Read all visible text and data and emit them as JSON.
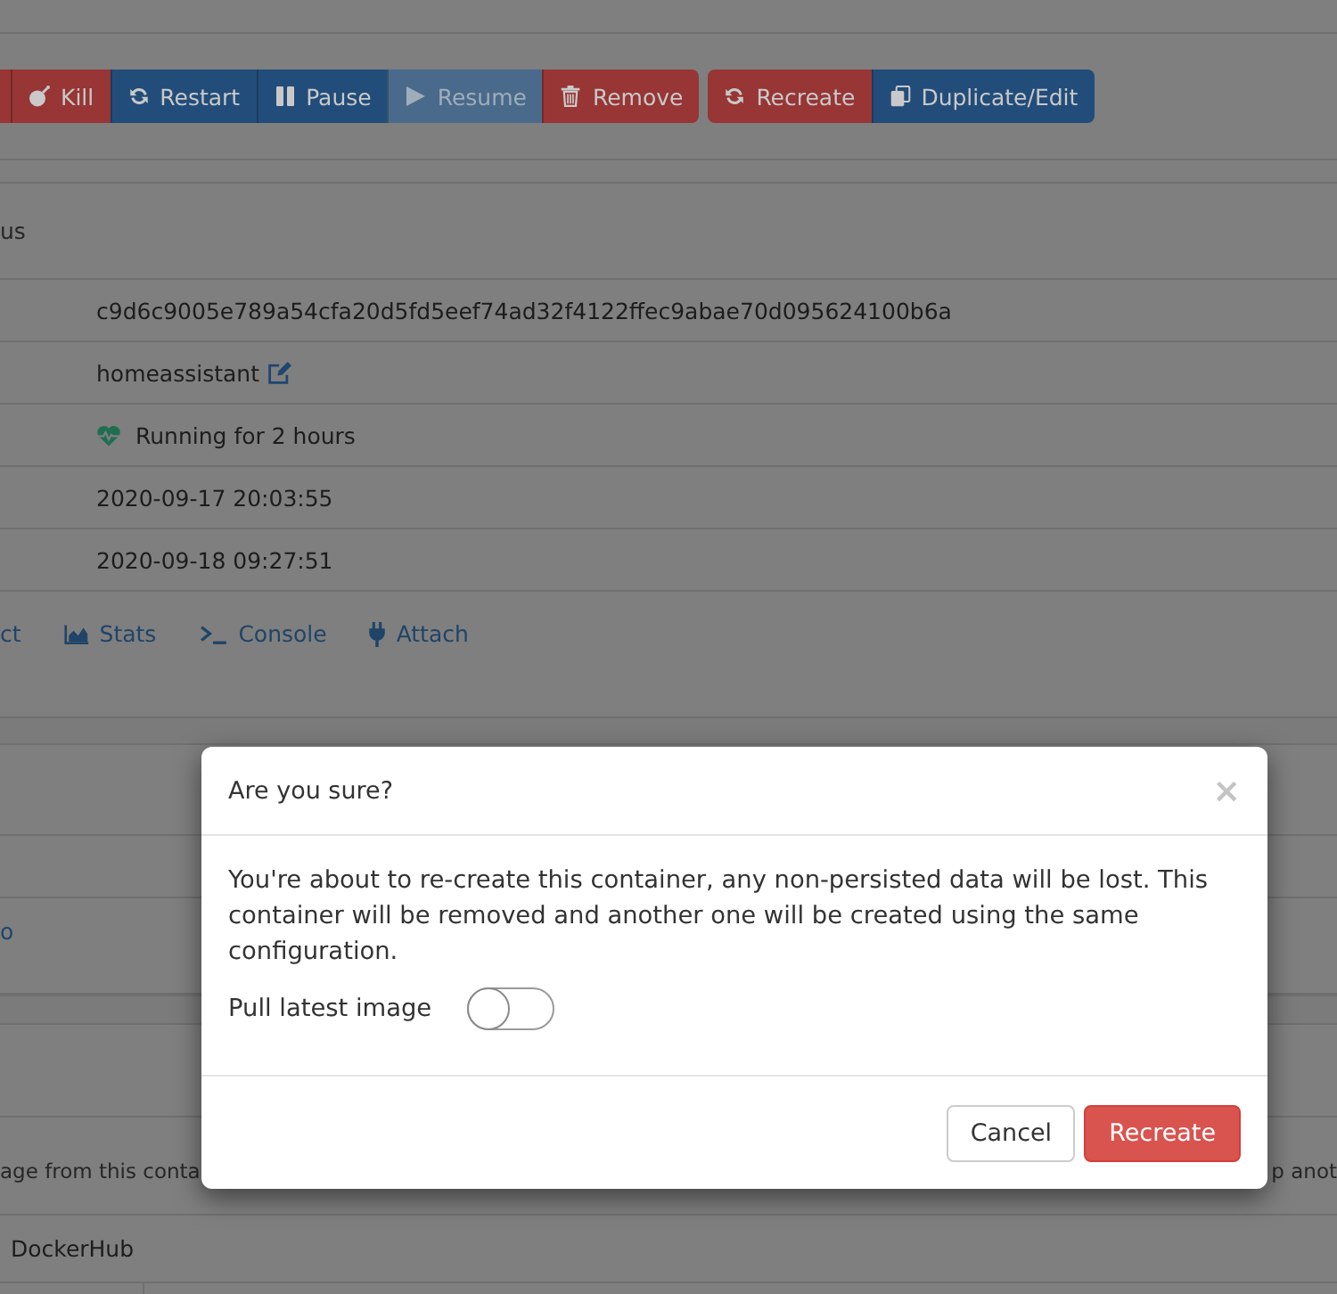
{
  "toolbar": {
    "groups": [
      [
        {
          "kind": "danger",
          "disabled": false
        },
        {
          "label": "Kill",
          "kind": "danger",
          "disabled": false
        },
        {
          "label": "Restart",
          "kind": "primary",
          "disabled": false
        },
        {
          "label": "Pause",
          "kind": "primary",
          "disabled": false
        },
        {
          "label": "Resume",
          "kind": "primary",
          "disabled": true
        },
        {
          "label": "Remove",
          "kind": "danger",
          "disabled": false
        }
      ],
      [
        {
          "label": "Recreate",
          "kind": "danger",
          "disabled": false
        },
        {
          "label": "Duplicate/Edit",
          "kind": "primary",
          "disabled": false
        }
      ]
    ]
  },
  "status_panel": {
    "header": "us",
    "rows": [
      {
        "kind": "text",
        "value": "c9d6c9005e789a54cfa20d5fd5eef74ad32f4122ffec9abae70d095624100b6a"
      },
      {
        "kind": "name",
        "value": "homeassistant"
      },
      {
        "kind": "status",
        "value": "Running for 2 hours"
      },
      {
        "kind": "text",
        "value": "2020-09-17 20:03:55"
      },
      {
        "kind": "text",
        "value": "2020-09-18 09:27:51"
      }
    ],
    "links": [
      {
        "label": "ct"
      },
      {
        "label": "Stats"
      },
      {
        "label": "Console"
      },
      {
        "label": "Attach"
      }
    ]
  },
  "panel_3": {
    "link": "o"
  },
  "panel_4": {
    "note_left": "age from this conta",
    "note_right": "p anot",
    "registry": "DockerHub"
  },
  "modal": {
    "title": "Are you sure?",
    "close": "×",
    "message": "You're about to re-create this container, any non-persisted data will be lost. This container will be removed and another one will be created using the same configuration.",
    "toggle": {
      "label": "Pull latest image",
      "on": false
    },
    "buttons": [
      {
        "label": "Cancel",
        "kind": "default"
      },
      {
        "label": "Recreate",
        "kind": "danger"
      }
    ]
  }
}
